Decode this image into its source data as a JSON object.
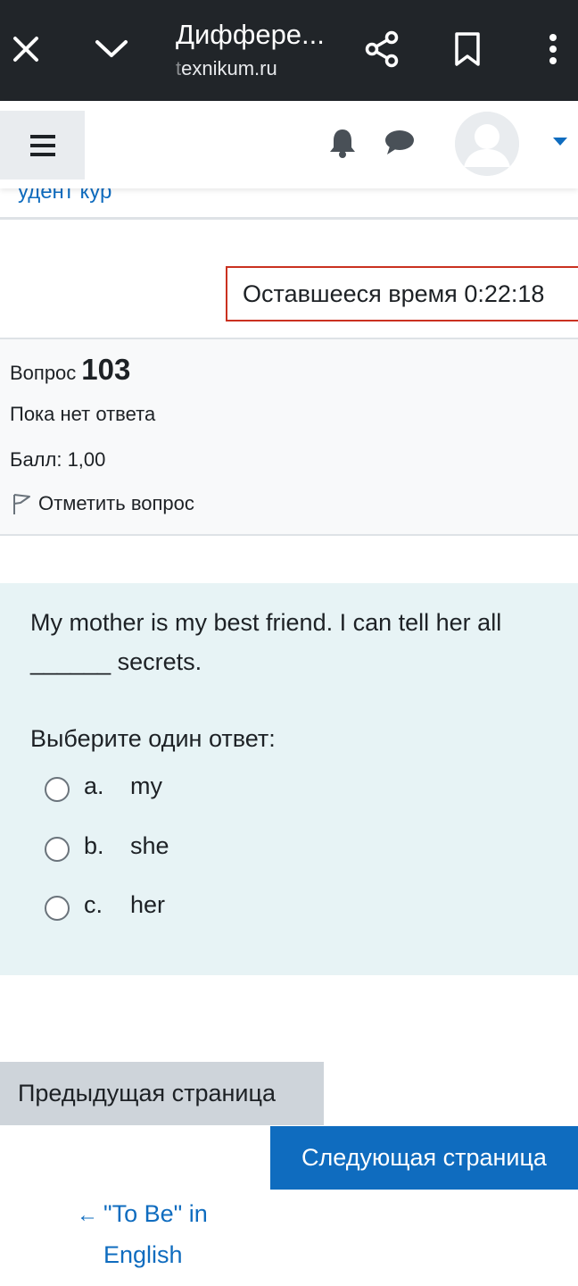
{
  "browser": {
    "tab_title": "Диффере...",
    "url_prefix": "t",
    "url_rest": "exnikum.ru"
  },
  "navbar": {
    "breadcrumb_partial": "удент    кур"
  },
  "quiz": {
    "timer_label": "Оставшееся время",
    "timer_value": "0:22:18",
    "question_label": "Вопрос",
    "question_number": "103",
    "state": "Пока нет ответа",
    "grade": "Балл: 1,00",
    "flag_label": "Отметить вопрос",
    "question_text": "My mother is my best friend. I can tell her all ______ secrets.",
    "prompt": "Выберите один ответ:",
    "options": [
      {
        "letter": "a.",
        "text": "my"
      },
      {
        "letter": "b.",
        "text": "she"
      },
      {
        "letter": "c.",
        "text": "her"
      }
    ]
  },
  "navigation": {
    "prev_page": "Предыдущая страница",
    "next_page": "Следующая страница",
    "prev_activity_arrow": "←",
    "prev_activity_line1": "\"To Be\" in",
    "prev_activity_line2": "English"
  },
  "colors": {
    "browser_bar": "#212529",
    "primary": "#0f6cbf",
    "timer_border": "#ca3120",
    "question_bg": "#e7f3f5"
  },
  "icons": [
    "close-icon",
    "chevron-down-icon",
    "share-icon",
    "bookmark-icon",
    "more-vert-icon",
    "hamburger-icon",
    "bell-icon",
    "chat-icon",
    "avatar",
    "caret-down-icon",
    "flag-icon"
  ]
}
